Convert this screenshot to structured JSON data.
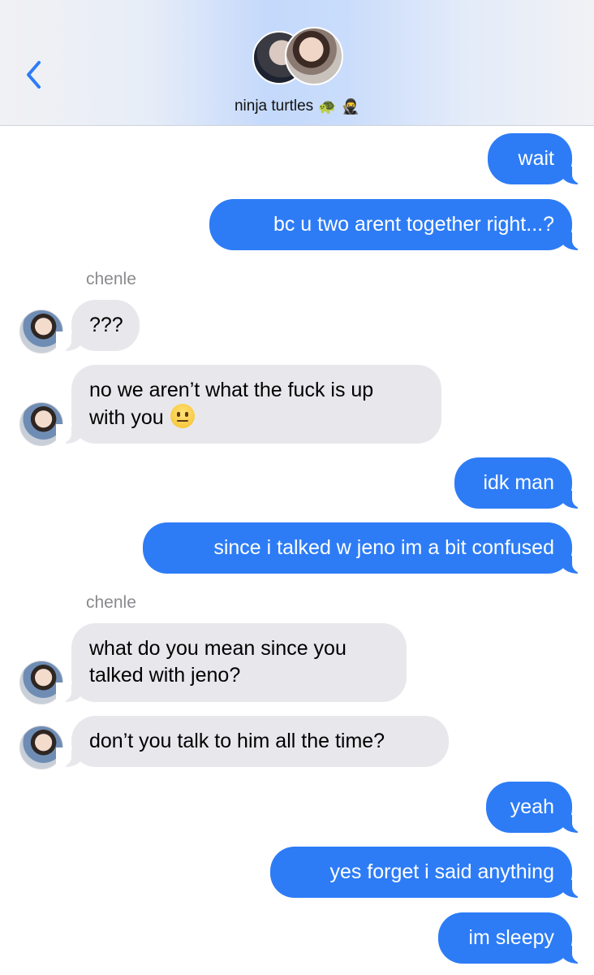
{
  "header": {
    "group_name": "ninja turtles",
    "name_icons": [
      "turtle-icon",
      "ninja-icon"
    ],
    "name_emoji_1": "🐢",
    "name_emoji_2": "🥷"
  },
  "colors": {
    "outgoing_bubble": "#2d7cf6",
    "incoming_bubble": "#e8e8ec",
    "sender_label": "#8a8a8e",
    "back_chevron": "#2d7cf6"
  },
  "messages": [
    {
      "id": "m1",
      "direction": "outgoing",
      "text": "wait"
    },
    {
      "id": "m2",
      "direction": "outgoing",
      "text": "bc u two arent together right...?"
    },
    {
      "id": "m3",
      "direction": "incoming",
      "sender": "chenle",
      "text": "???"
    },
    {
      "id": "m4",
      "direction": "incoming",
      "text_line1": "no we aren’t what the fuck is up",
      "text_line2": "with you",
      "emoji": "neutral-face-icon"
    },
    {
      "id": "m5",
      "direction": "outgoing",
      "text": "idk man"
    },
    {
      "id": "m6",
      "direction": "outgoing",
      "text": "since i talked w jeno im a bit confused"
    },
    {
      "id": "m7",
      "direction": "incoming",
      "sender": "chenle",
      "text_line1": "what do you mean since you",
      "text_line2": "talked with jeno?"
    },
    {
      "id": "m8",
      "direction": "incoming",
      "text": "don’t you talk to him all the time?"
    },
    {
      "id": "m9",
      "direction": "outgoing",
      "text": "yeah"
    },
    {
      "id": "m10",
      "direction": "outgoing",
      "text": "yes forget i said anything"
    },
    {
      "id": "m11",
      "direction": "outgoing",
      "text": "im sleepy"
    }
  ]
}
